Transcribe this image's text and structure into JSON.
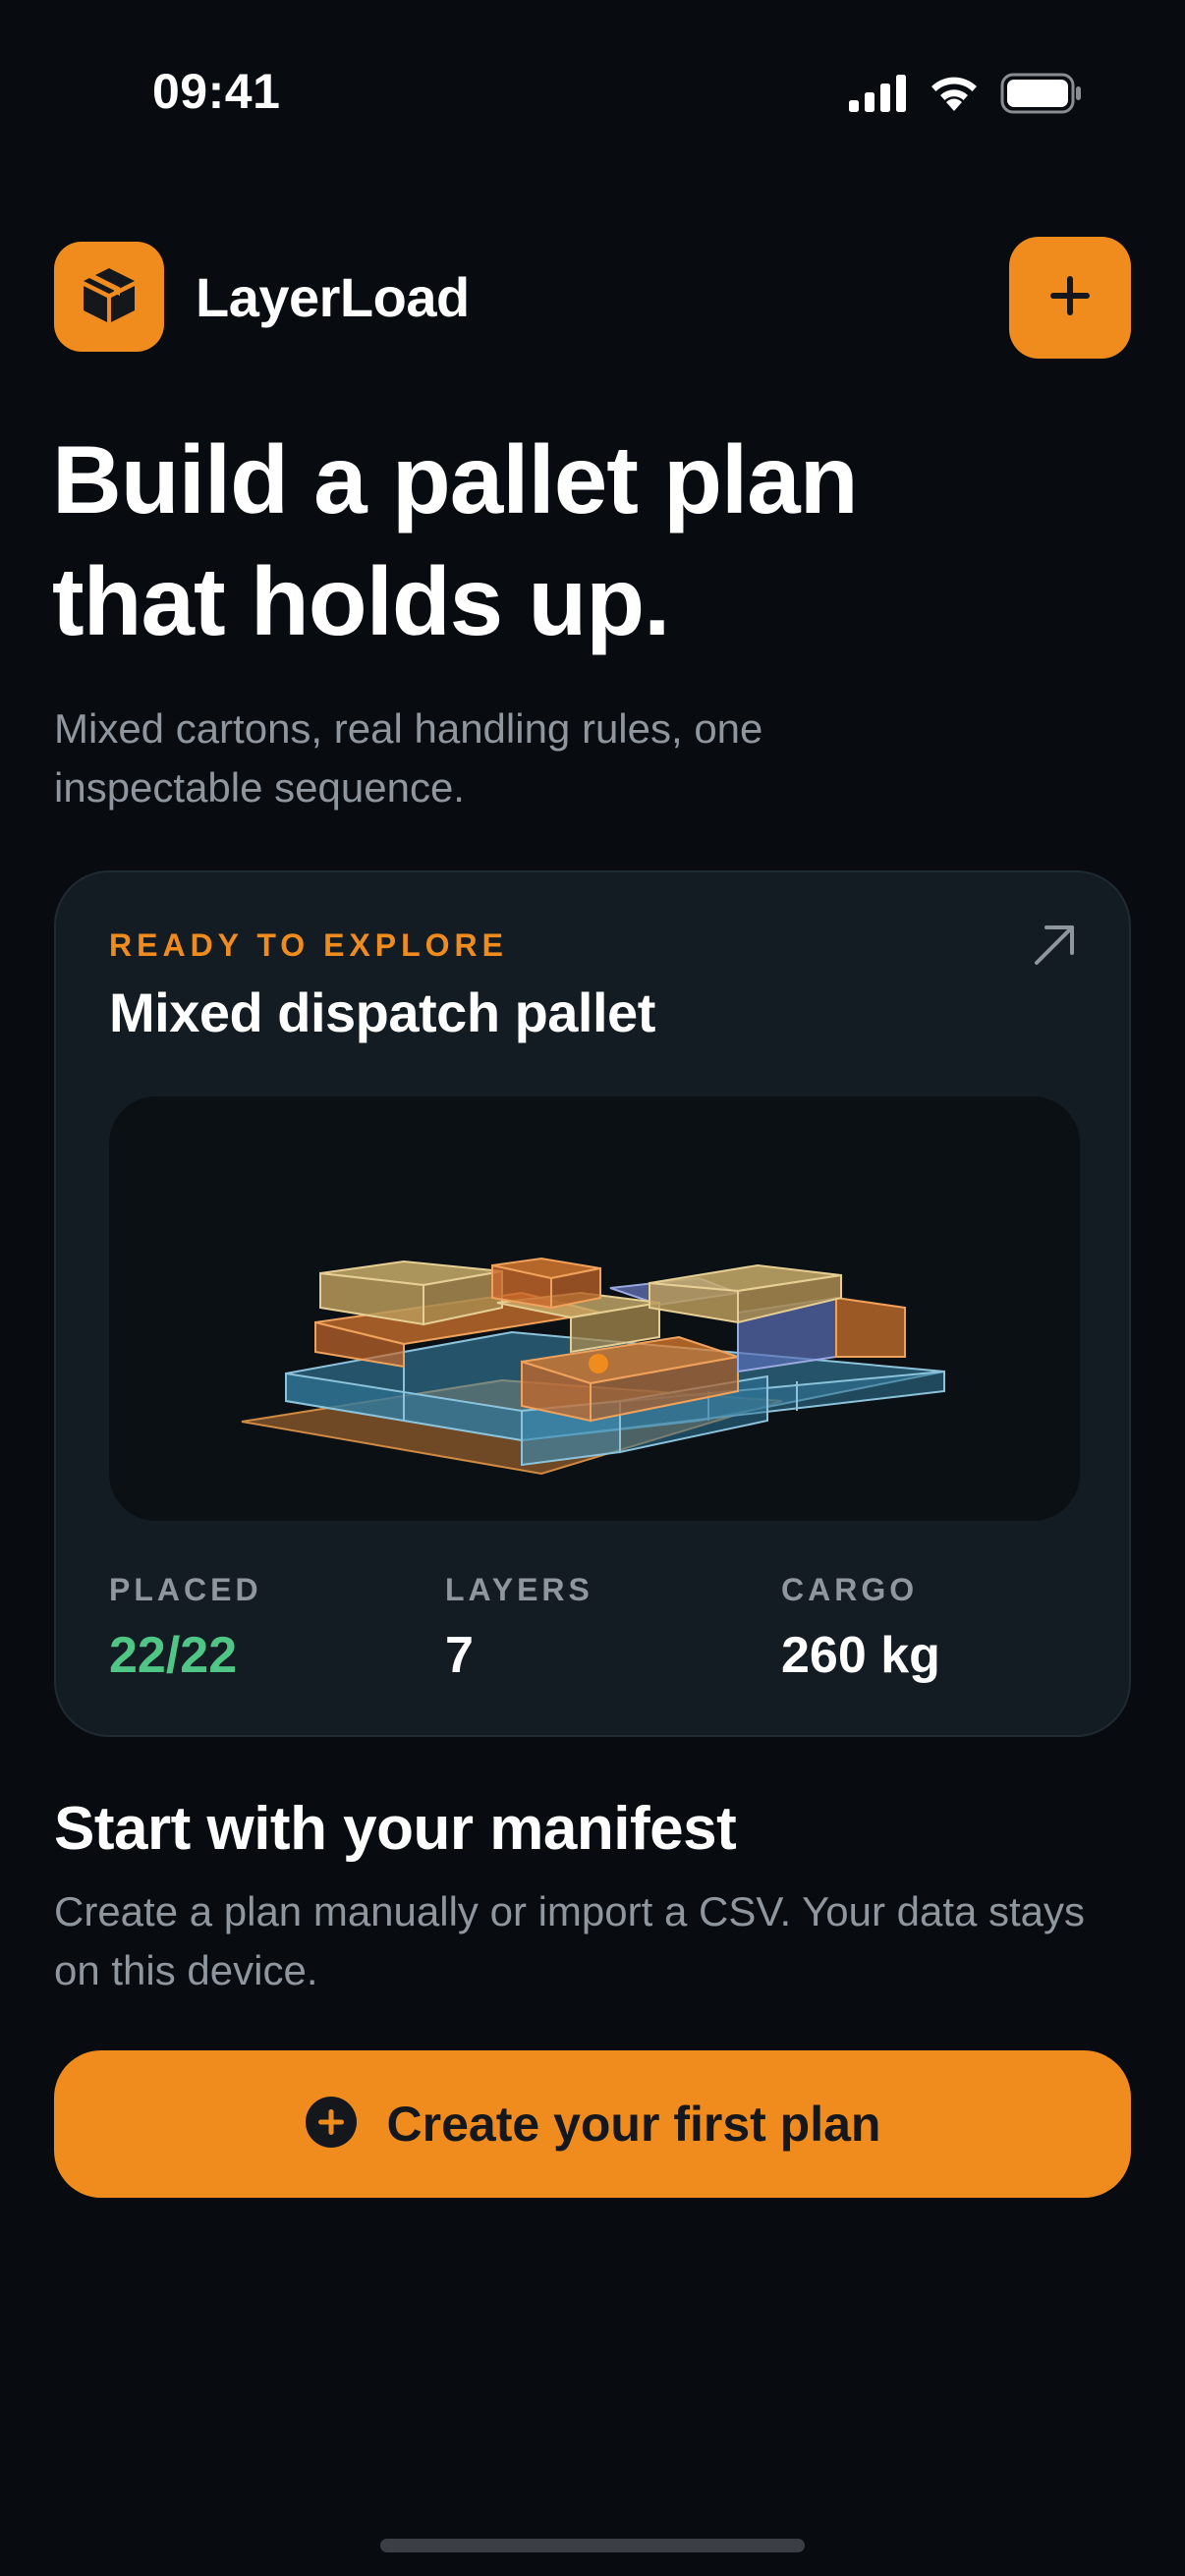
{
  "status_bar": {
    "time": "09:41",
    "icons": [
      "cellular-signal-icon",
      "wifi-icon",
      "battery-icon"
    ]
  },
  "header": {
    "logo_icon": "cube-box-icon",
    "app_name": "LayerLoad",
    "add_icon": "plus-icon"
  },
  "hero": {
    "title": "Build a pallet plan that holds up.",
    "subtitle": "Mixed cartons, real handling rules, one inspectable sequence."
  },
  "sample_card": {
    "eyebrow": "READY TO EXPLORE",
    "title": "Mixed dispatch pallet",
    "open_icon": "arrow-up-right-icon",
    "preview_icon": "pallet-3d-preview",
    "stats": {
      "placed_label": "PLACED",
      "placed_value": "22/22",
      "layers_label": "LAYERS",
      "layers_value": "7",
      "cargo_label": "CARGO",
      "cargo_value": "260 kg"
    }
  },
  "manifest": {
    "title": "Start with your manifest",
    "description": "Create a plan manually or import a CSV. Your data stays on this device.",
    "cta_icon": "plus-circle-icon",
    "cta_label": "Create your first plan"
  },
  "colors": {
    "background": "#080c11",
    "card": "#141c23",
    "accent": "#f08c1d",
    "success": "#4fc685",
    "muted_text": "#8f969e"
  }
}
